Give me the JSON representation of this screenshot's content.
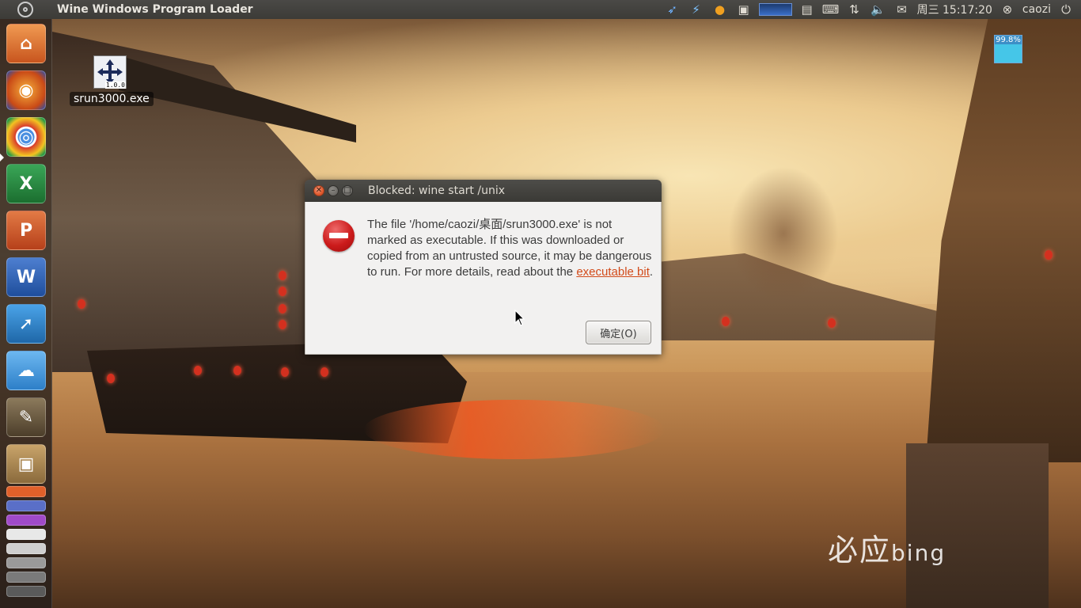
{
  "top_panel": {
    "app_title": "Wine Windows Program Loader",
    "indicators": {
      "messaging_icon": "messaging-icon",
      "power_icon": "lightning-icon",
      "weather_icon": "sun-icon",
      "clock": "周三 15:17:20",
      "user": "caozi"
    }
  },
  "launcher": {
    "items": [
      {
        "name": "home-folder",
        "glyph": "⌂",
        "color": "#d96a2a"
      },
      {
        "name": "firefox",
        "glyph": "◉",
        "color": "#e3731d"
      },
      {
        "name": "chrome",
        "glyph": "◎",
        "color": "#3b8ed8"
      },
      {
        "name": "excel",
        "glyph": "X",
        "color": "#1e7a32"
      },
      {
        "name": "powerpoint",
        "glyph": "P",
        "color": "#c84a1c"
      },
      {
        "name": "word",
        "glyph": "W",
        "color": "#2a5aa8"
      },
      {
        "name": "app-blue",
        "glyph": "➚",
        "color": "#2f7fc2"
      },
      {
        "name": "cloud",
        "glyph": "☁",
        "color": "#4a9ad8"
      },
      {
        "name": "gimp",
        "glyph": "✎",
        "color": "#6b5a42"
      },
      {
        "name": "ubuntu-software-center",
        "glyph": "▣",
        "color": "#b08a54"
      }
    ]
  },
  "desktop": {
    "icon_label": "srun3000.exe",
    "icon_version": "1.0.0"
  },
  "cpu_monitor": {
    "text": "99.8%",
    "level": 0.998
  },
  "dialog": {
    "title": "Blocked: wine start /unix",
    "message": "The file '/home/caozi/桌面/srun3000.exe' is not marked as executable.  If this was downloaded or copied from an untrusted source, it may be dangerous to run.  For more details, read about the ",
    "link": "executable bit",
    "message_end": ".",
    "ok_button": "确定(O)"
  },
  "wallpaper": {
    "watermark_cn": "必应",
    "watermark_en": "bing"
  }
}
